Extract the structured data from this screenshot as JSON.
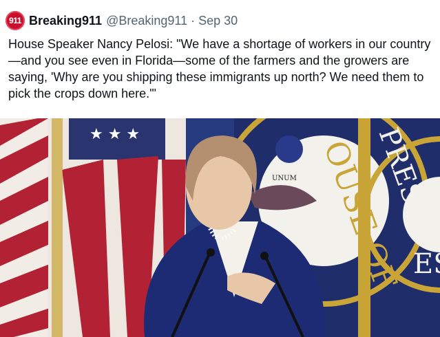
{
  "tweet": {
    "avatar_label": "911",
    "display_name": "Breaking911",
    "handle": "@Breaking911",
    "separator": "·",
    "date": "Sep 30",
    "text": "House Speaker Nancy Pelosi: \"We have a shortage of workers in our country—and you see even in Florida—some of the farmers and the growers are saying, 'Why are you shipping these immigrants up north? We need them to pick the crops down here.'\""
  },
  "media": {
    "seal_text_1": "OUSE OF",
    "seal_text_2": "PRESEN",
    "seal_text_3": "ES",
    "seal_small_text": "UNUM"
  },
  "colors": {
    "accent_red": "#c8102e",
    "flag_red": "#b22234",
    "flag_blue": "#2a3570",
    "backdrop_navy": "#1f2d6b",
    "seal_gold": "#c9a436",
    "secondary_text": "#536471"
  }
}
